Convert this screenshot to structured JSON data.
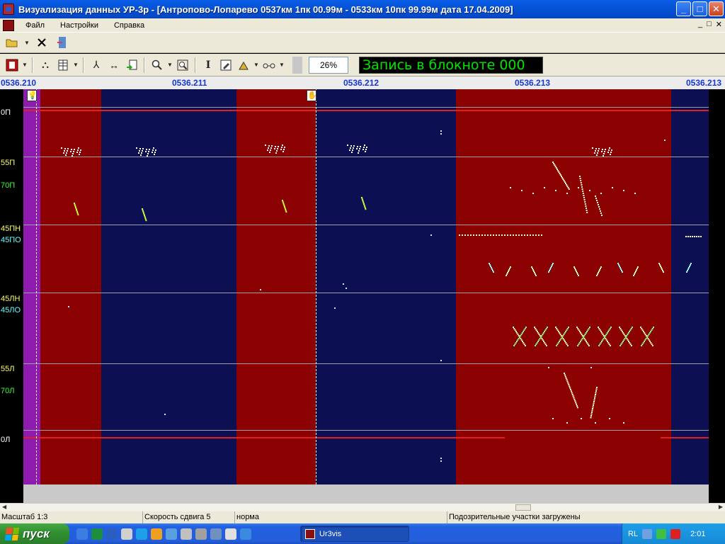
{
  "window": {
    "title": "Визуализация данных УР-3р - [Антропово-Лопарево 0537км 1пк 00.99м - 0533км 10пк 99.99м дата 17.04.2009]",
    "min_label": "_",
    "max_label": "□",
    "close_label": "✕"
  },
  "menu": {
    "items": [
      "Файл",
      "Настройки",
      "Справка"
    ],
    "mdi": [
      "_",
      "□",
      "✕"
    ]
  },
  "toolbar": {
    "zoom_value": "26%",
    "notebook_text": "Запись в блокноте 000"
  },
  "ruler": {
    "labels": [
      "0536.210",
      "0536.211",
      "0536.212",
      "0536.213",
      "0536.213"
    ]
  },
  "tracks": {
    "labels": [
      {
        "text": "0П",
        "color": "#ffffff"
      },
      {
        "text": "55П",
        "color": "#ffff66"
      },
      {
        "text": "70П",
        "color": "#33ff33"
      },
      {
        "text": "45ПН",
        "color": "#ffff66"
      },
      {
        "text": "45ПО",
        "color": "#66ffff"
      },
      {
        "text": "45ЛН",
        "color": "#ffff66"
      },
      {
        "text": "45ЛО",
        "color": "#66ffff"
      },
      {
        "text": "55Л",
        "color": "#ffff66"
      },
      {
        "text": "70Л",
        "color": "#33ff33"
      },
      {
        "text": "0Л",
        "color": "#ffffff"
      }
    ]
  },
  "colors": {
    "red_band": "#8b0000",
    "blue_band": "#0c0f52",
    "purple_band": "#8e1ab0"
  },
  "status": {
    "scale": "Масштаб 1:3",
    "speed": "Скорость сдвига 5",
    "state": "норма",
    "message": "Подозрительные участки загружены"
  },
  "taskbar": {
    "start_label": "пуск",
    "task_label": "Ur3vis",
    "lang": "RL",
    "time": "2:01"
  }
}
